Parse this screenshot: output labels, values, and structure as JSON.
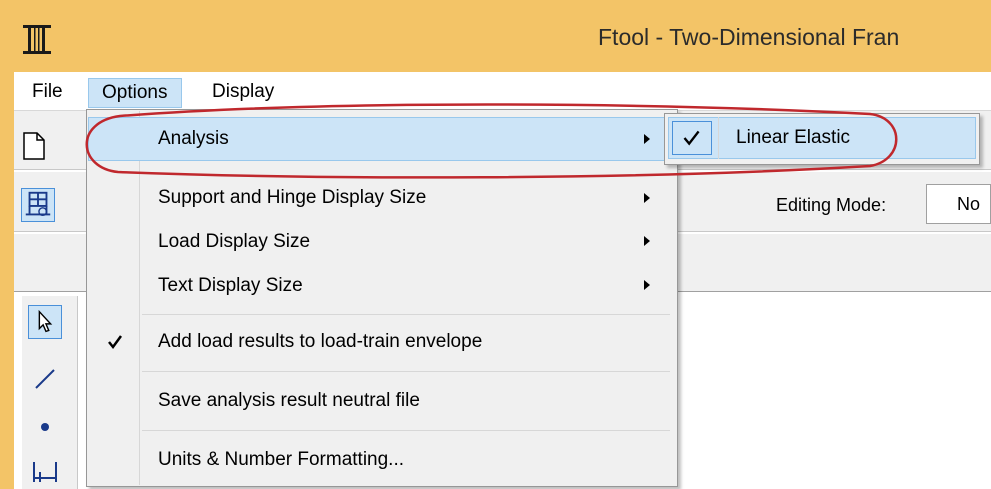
{
  "window": {
    "title": "Ftool - Two-Dimensional Fran",
    "app_icon": "ftool-pi-icon"
  },
  "menubar": {
    "items": [
      {
        "label": "File"
      },
      {
        "label": "Options"
      },
      {
        "label": "Display"
      }
    ]
  },
  "toolbar": {
    "new_icon": "new-document-icon",
    "model_icon": "frame-model-icon",
    "editing_mode_label": "Editing Mode:",
    "editing_mode_value": "No"
  },
  "toolstrip": {
    "tools": [
      {
        "icon": "pointer-arrow-icon"
      },
      {
        "icon": "line-member-icon"
      },
      {
        "icon": "node-dot-icon"
      },
      {
        "icon": "support-icon"
      }
    ]
  },
  "options_menu": {
    "items": [
      {
        "label": "Analysis",
        "submenu": true,
        "checked": false,
        "highlighted": true
      },
      {
        "label": "Support and Hinge Display Size",
        "submenu": true,
        "checked": false
      },
      {
        "label": "Load Display Size",
        "submenu": true,
        "checked": false
      },
      {
        "label": "Text Display Size",
        "submenu": true,
        "checked": false
      },
      {
        "label": "Add load results to load-train envelope",
        "submenu": false,
        "checked": true
      },
      {
        "label": "Save analysis result neutral file",
        "submenu": false,
        "checked": false
      },
      {
        "label": "Units & Number Formatting...",
        "submenu": false,
        "checked": false
      }
    ]
  },
  "analysis_submenu": {
    "items": [
      {
        "label": "Linear Elastic",
        "checked": true
      }
    ]
  },
  "colors": {
    "title_bar": "#f3c467",
    "menu_highlight": "#cce4f7",
    "menu_highlight_border": "#99c8ec",
    "annotation_red": "#c0282d"
  }
}
